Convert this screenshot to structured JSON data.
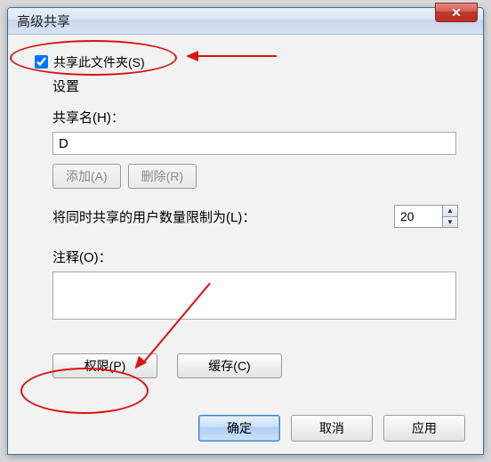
{
  "window": {
    "title": "高级共享",
    "close_glyph": "✕"
  },
  "share_checkbox": {
    "label": "共享此文件夹(S)",
    "checked": true
  },
  "group_label": "设置",
  "share_name": {
    "label": "共享名(H)：",
    "value": "D"
  },
  "buttons": {
    "add": "添加(A)",
    "remove": "删除(R)",
    "permissions": "权限(P)",
    "cache": "缓存(C)"
  },
  "limit": {
    "label": "将同时共享的用户数量限制为(L)：",
    "value": "20"
  },
  "comment": {
    "label": "注释(O)：",
    "value": ""
  },
  "footer": {
    "ok": "确定",
    "cancel": "取消",
    "apply": "应用"
  }
}
